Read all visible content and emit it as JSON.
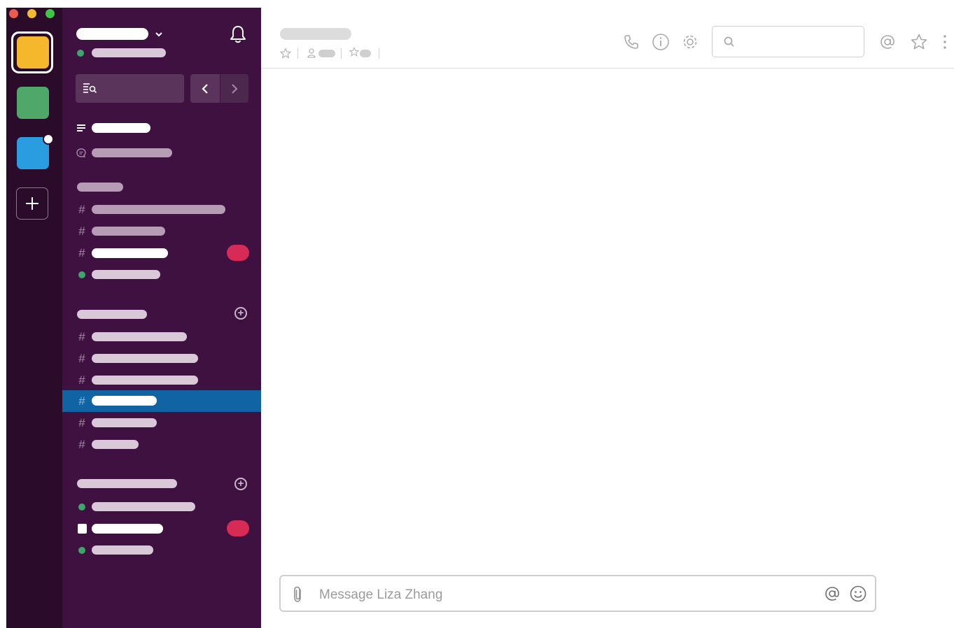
{
  "window": {
    "traffic_lights": {
      "close": "#ed5a52",
      "minimize": "#f2bb2d",
      "maximize": "#3fc646"
    }
  },
  "workspaces": {
    "tiles": [
      {
        "name": "workspace-yellow",
        "color": "#f5b82d",
        "active": true
      },
      {
        "name": "workspace-green",
        "color": "#4fa86a",
        "active": false
      },
      {
        "name": "workspace-blue",
        "color": "#2a9ce0",
        "active": false,
        "notification": true
      }
    ],
    "add_icon": "plus-icon"
  },
  "sidebar": {
    "header": {
      "menu_icon": "chevron-down-icon",
      "notifications_icon": "bell-icon"
    },
    "quick_switcher_icon": "jump-search-icon",
    "nav": {
      "back_icon": "chevron-left-icon",
      "forward_icon": "chevron-right-icon"
    },
    "selected_color": "#1164a3",
    "badge_color": "#d72b56"
  },
  "header": {
    "meta_icons": [
      "star-icon",
      "member-icon",
      "pin-icon"
    ],
    "actions": [
      "phone-icon",
      "info-icon",
      "gear-icon",
      "mention-icon",
      "star-icon",
      "more-icon"
    ],
    "search": {
      "placeholder": "",
      "icon": "search-icon"
    }
  },
  "composer": {
    "placeholder": "Message Liza Zhang",
    "attach_icon": "paperclip-icon",
    "mention_icon": "at-icon",
    "emoji_icon": "smiley-icon"
  }
}
